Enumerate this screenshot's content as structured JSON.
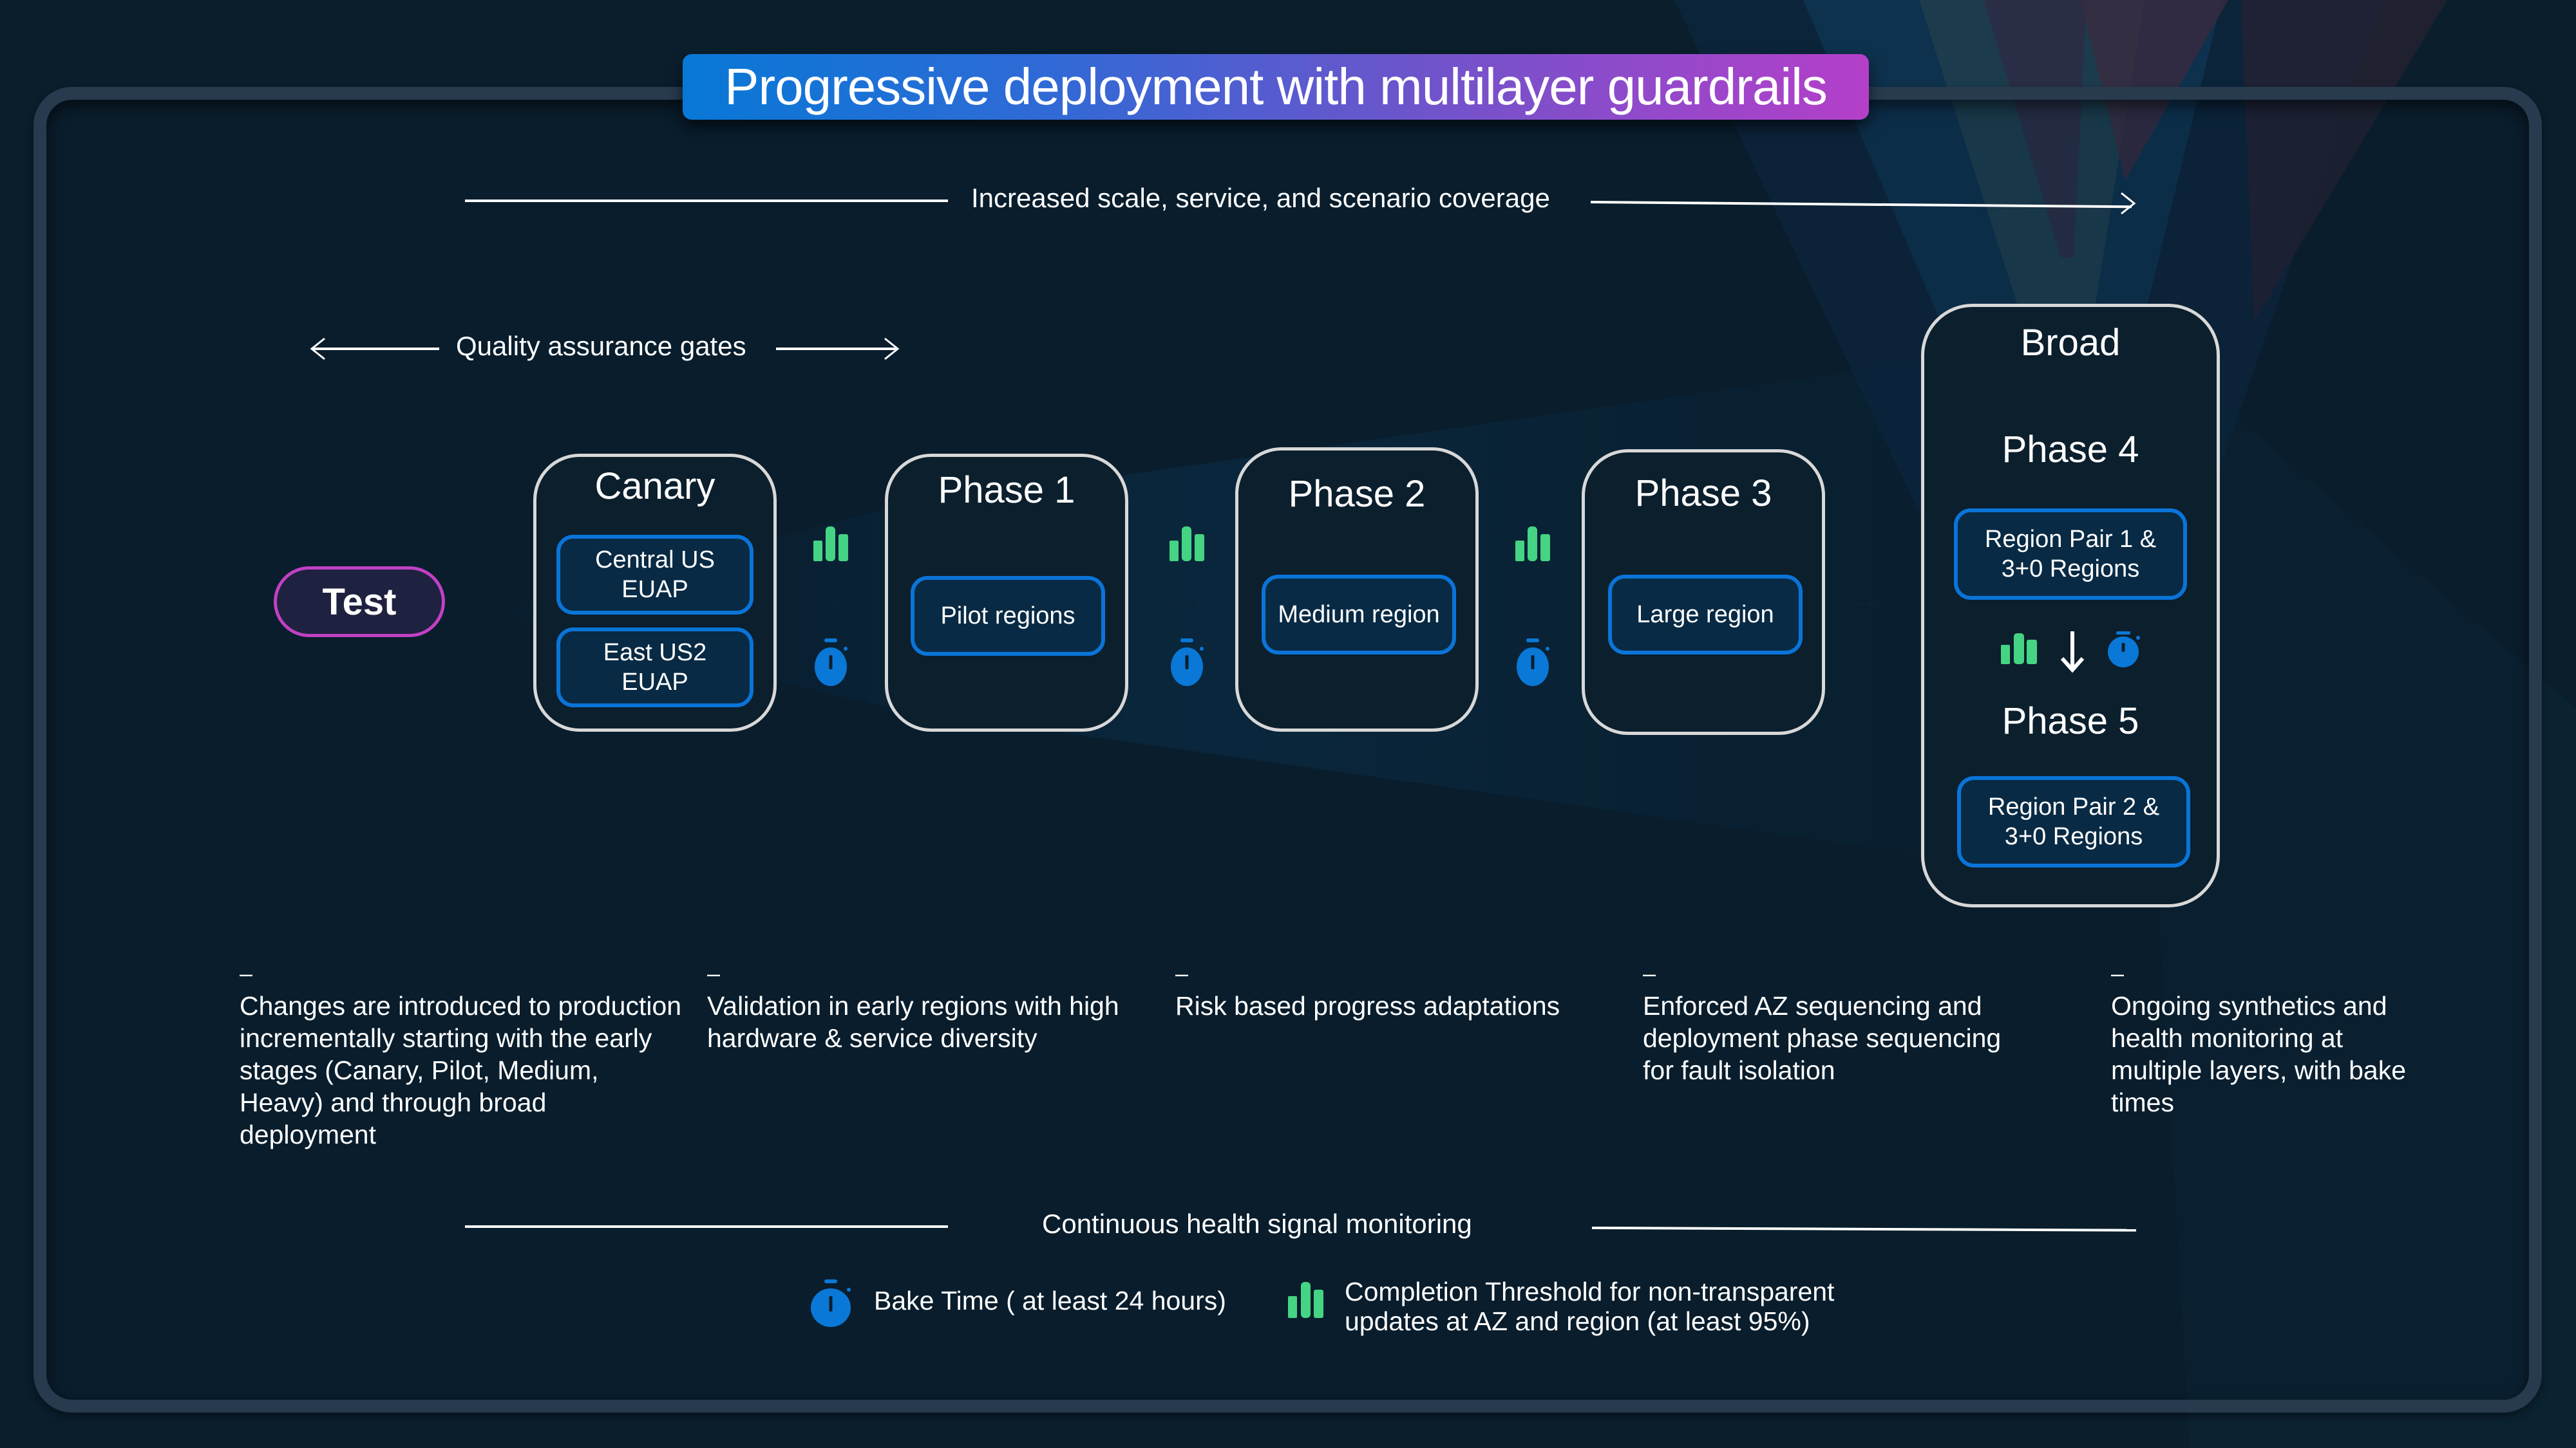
{
  "title": "Progressive deployment with multilayer guardrails",
  "top_arrow_label": "Increased scale, service, and scenario coverage",
  "qa_arrow_label": "Quality assurance gates",
  "test_label": "Test",
  "stages": [
    {
      "title": "Canary",
      "regions": [
        "Central US EUAP",
        "East US2 EUAP"
      ]
    },
    {
      "title": "Phase 1",
      "regions": [
        "Pilot regions"
      ]
    },
    {
      "title": "Phase 2",
      "regions": [
        "Medium region"
      ]
    },
    {
      "title": "Phase 3",
      "regions": [
        "Large region"
      ]
    }
  ],
  "broad": {
    "title": "Broad",
    "phases": [
      {
        "title": "Phase 4",
        "region": "Region Pair 1 & 3+0 Regions"
      },
      {
        "title": "Phase 5",
        "region": "Region Pair 2 & 3+0 Regions"
      }
    ]
  },
  "descriptions": [
    {
      "dash": "–",
      "text": "Changes are introduced to production incrementally starting with the early stages (Canary, Pilot, Medium, Heavy) and through broad deployment"
    },
    {
      "dash": "–",
      "text": "Validation in early regions with high hardware & service diversity"
    },
    {
      "dash": "–",
      "text": "Risk based progress adaptations"
    },
    {
      "dash": "–",
      "text": "Enforced AZ sequencing and deployment phase sequencing for fault isolation"
    },
    {
      "dash": "–",
      "text": "Ongoing  synthetics and health monitoring at multiple layers, with bake times"
    }
  ],
  "monitoring_label": "Continuous health signal monitoring",
  "legend": {
    "bake_time": {
      "icon": "stopwatch-icon",
      "label": "Bake Time ( at least 24 hours)"
    },
    "completion_threshold": {
      "icon": "bar-chart-icon",
      "label": "Completion Threshold for non-transparent updates at AZ and region (at least 95%)"
    }
  },
  "colors": {
    "background": "#0a1e2c",
    "frame": "#273a4e",
    "title_gradient_start": "#0878d6",
    "title_gradient_end": "#b43fc9",
    "test_border": "#c141c4",
    "region_border": "#0a74d8",
    "stopwatch": "#0a78d6",
    "chart_icon": "#45d483"
  }
}
